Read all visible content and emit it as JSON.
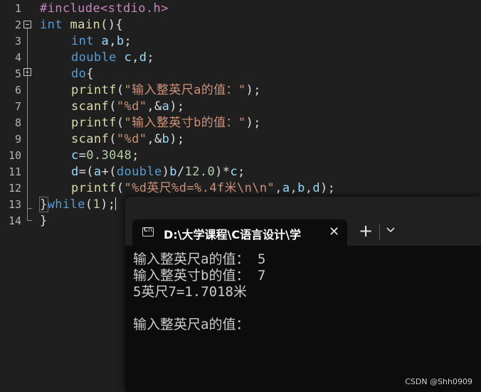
{
  "editor": {
    "lines": [
      {
        "n": "1",
        "parts": [
          [
            "pp",
            "#include<stdio.h>"
          ]
        ]
      },
      {
        "n": "2",
        "parts": [
          [
            "kw",
            "int"
          ],
          [
            "p",
            " "
          ],
          [
            "fn",
            "main"
          ],
          [
            "p",
            "(){"
          ]
        ]
      },
      {
        "n": "3",
        "parts": [
          [
            "kw",
            "int"
          ],
          [
            "p",
            " "
          ],
          [
            "var",
            "a"
          ],
          [
            "p",
            ","
          ],
          [
            "var",
            "b"
          ],
          [
            "p",
            ";"
          ]
        ]
      },
      {
        "n": "4",
        "parts": [
          [
            "kw",
            "double"
          ],
          [
            "p",
            " "
          ],
          [
            "var",
            "c"
          ],
          [
            "p",
            ","
          ],
          [
            "var",
            "d"
          ],
          [
            "p",
            ";"
          ]
        ]
      },
      {
        "n": "5",
        "parts": [
          [
            "kw",
            "do"
          ],
          [
            "p",
            "{"
          ]
        ]
      },
      {
        "n": "6",
        "parts": [
          [
            "fn",
            "printf"
          ],
          [
            "p",
            "("
          ],
          [
            "str",
            "\"输入整英尺a的值：\""
          ],
          [
            "p",
            ");"
          ]
        ]
      },
      {
        "n": "7",
        "parts": [
          [
            "fn",
            "scanf"
          ],
          [
            "p",
            "("
          ],
          [
            "str",
            "\"%d\""
          ],
          [
            "p",
            ",&"
          ],
          [
            "var",
            "a"
          ],
          [
            "p",
            ");"
          ]
        ]
      },
      {
        "n": "8",
        "parts": [
          [
            "fn",
            "printf"
          ],
          [
            "p",
            "("
          ],
          [
            "str",
            "\"输入整英寸b的值：\""
          ],
          [
            "p",
            ");"
          ]
        ]
      },
      {
        "n": "9",
        "parts": [
          [
            "fn",
            "scanf"
          ],
          [
            "p",
            "("
          ],
          [
            "str",
            "\"%d\""
          ],
          [
            "p",
            ",&"
          ],
          [
            "var",
            "b"
          ],
          [
            "p",
            ");"
          ]
        ]
      },
      {
        "n": "10",
        "parts": [
          [
            "var",
            "c"
          ],
          [
            "p",
            "="
          ],
          [
            "num",
            "0.3048"
          ],
          [
            "p",
            ";"
          ]
        ]
      },
      {
        "n": "11",
        "parts": [
          [
            "var",
            "d"
          ],
          [
            "p",
            "=("
          ],
          [
            "var",
            "a"
          ],
          [
            "p",
            "+("
          ],
          [
            "kw",
            "double"
          ],
          [
            "p",
            ")"
          ],
          [
            "var",
            "b"
          ],
          [
            "p",
            "/"
          ],
          [
            "num",
            "12.0"
          ],
          [
            "p",
            ")*"
          ],
          [
            "var",
            "c"
          ],
          [
            "p",
            ";"
          ]
        ]
      },
      {
        "n": "12",
        "parts": [
          [
            "fn",
            "printf"
          ],
          [
            "p",
            "("
          ],
          [
            "str",
            "\"%d英尺%d=%.4f米\\n\\n\""
          ],
          [
            "p",
            ","
          ],
          [
            "var",
            "a"
          ],
          [
            "p",
            ","
          ],
          [
            "var",
            "b"
          ],
          [
            "p",
            ","
          ],
          [
            "var",
            "d"
          ],
          [
            "p",
            ");"
          ]
        ]
      },
      {
        "n": "13",
        "parts": [
          [
            "p",
            "}"
          ],
          [
            "kw",
            "while"
          ],
          [
            "p",
            "("
          ],
          [
            "num",
            "1"
          ],
          [
            "p",
            ");"
          ]
        ]
      },
      {
        "n": "14",
        "parts": [
          [
            "p",
            "}"
          ]
        ]
      }
    ]
  },
  "terminal": {
    "tab_title": "D:\\大学课程\\C语言设计\\学",
    "close_glyph": "✕",
    "new_tab_glyph": "+",
    "output": [
      "输入整英尺a的值： 5",
      "输入整英寸b的值： 7",
      "5英尺7=1.7018米",
      "",
      "输入整英尺a的值："
    ]
  },
  "watermark": "CSDN @Shh0909",
  "colors": {
    "editor_bg": "#1f1f1f",
    "terminal_bg": "#0c0c0c",
    "keyword": "#569cd6",
    "string": "#ce9178",
    "function": "#dcdcaa",
    "preprocessor": "#c586c0"
  }
}
